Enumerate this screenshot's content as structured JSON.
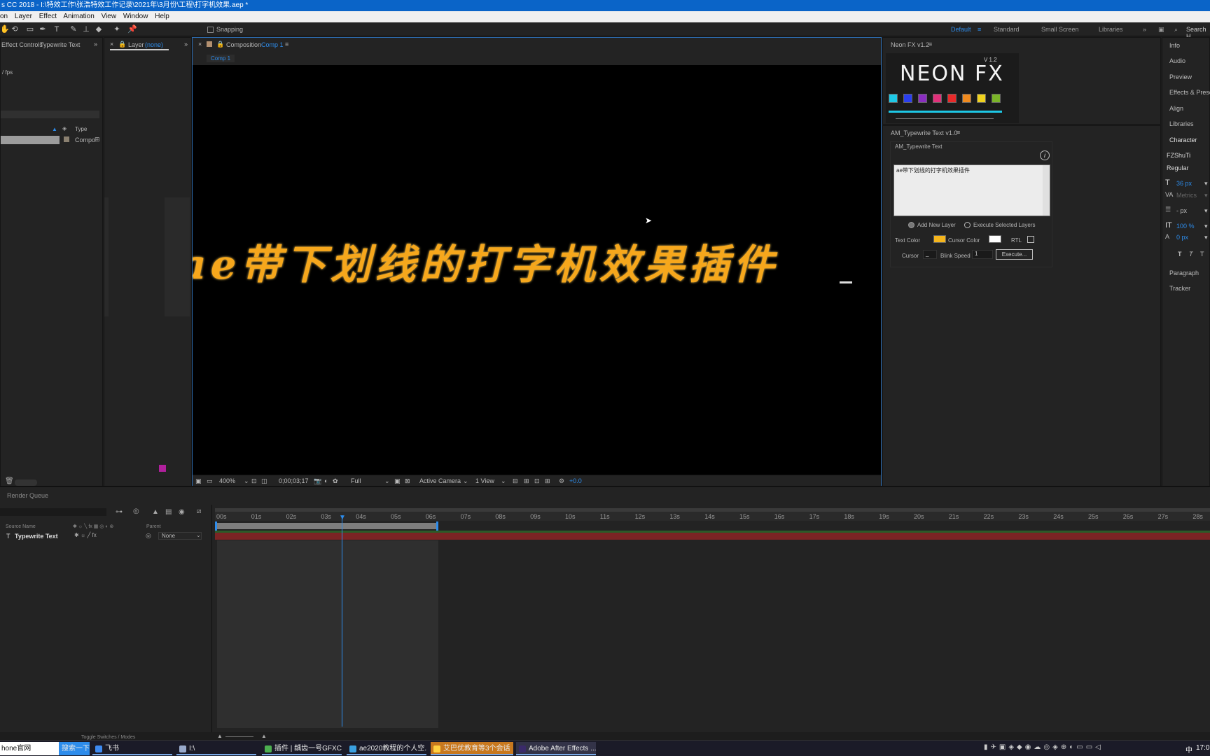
{
  "window": {
    "title": "s CC 2018 - I:\\特效工作\\张浩特效工作记录\\2021年\\3月份\\工程\\打字机效果.aep *"
  },
  "menu": [
    "on",
    "Layer",
    "Effect",
    "Animation",
    "View",
    "Window",
    "Help"
  ],
  "toolbar": {
    "snapping": "Snapping",
    "workspaces": [
      "Default",
      "Standard",
      "Small Screen",
      "Libraries"
    ],
    "search_placeholder": "Search H"
  },
  "left_panel": {
    "tab_effect_controls": "Effect Controls",
    "tab_layer_name": "Typewrite Text",
    "fps_text": "/ fps",
    "col_type": "Type",
    "row_type": "Compo"
  },
  "layer_panel": {
    "label": "Layer",
    "value": "(none)"
  },
  "composition": {
    "label": "Composition",
    "name": "Comp 1",
    "crumb": "Comp 1",
    "viewer_text": "ae带下划线的打字机效果插件"
  },
  "viewer_bar": {
    "zoom": "400%",
    "timecode": "0;00;03;17",
    "resolution": "Full",
    "camera": "Active Camera",
    "views": "1 View",
    "exposure": "+0.0"
  },
  "neon_fx": {
    "title": "Neon FX v1.2",
    "logo": "NEON FX",
    "version": "V 1.2",
    "colors": [
      "#1ec8e6",
      "#2a3ff0",
      "#8a2ec0",
      "#e0307a",
      "#e82a2a",
      "#f08a1e",
      "#f0d21e",
      "#7ab428"
    ],
    "accent": "#1ec8e6"
  },
  "typewrite": {
    "title": "AM_Typewrite Text v1.0",
    "group": "AM_Typewrite Text",
    "text_value": "ae带下划线的打字机效果插件",
    "opt_add": "Add New Layer",
    "opt_execute": "Execute Selected Layers",
    "text_color_label": "Text Color",
    "text_color": "#f5b51c",
    "cursor_color_label": "Cursor Color",
    "cursor_color": "#ffffff",
    "rtl_label": "RTL",
    "cursor_label": "Cursor",
    "cursor_value": "_",
    "blink_label": "Blink Speed",
    "blink_value": "1",
    "execute_button": "Execute..."
  },
  "right_panels": [
    "Info",
    "Audio",
    "Preview",
    "Effects & Presets",
    "Align",
    "Libraries",
    "Character"
  ],
  "character": {
    "font": "FZShuTi",
    "style": "Regular",
    "size": "36 px",
    "kerning": "Metrics",
    "leading_unit": "- px",
    "vscale": "100 %",
    "baseline": "0 px"
  },
  "right_panels_bottom": [
    "Paragraph",
    "Tracker"
  ],
  "timeline": {
    "render_queue": "Render Queue",
    "col_source": "Source Name",
    "col_parent": "Parent",
    "layer_name": "Typewrite Text",
    "parent_value": "None",
    "toggle": "Toggle Switches / Modes",
    "ruler": [
      "00s",
      "01s",
      "02s",
      "03s",
      "04s",
      "05s",
      "06s",
      "07s",
      "08s",
      "09s",
      "10s",
      "11s",
      "12s",
      "13s",
      "14s",
      "15s",
      "16s",
      "17s",
      "18s",
      "19s",
      "20s",
      "21s",
      "22s",
      "23s",
      "24s",
      "25s",
      "26s",
      "27s",
      "28s"
    ]
  },
  "taskbar": {
    "items": [
      "hone官网",
      "搜索一下",
      "飞书",
      "I:\\",
      "插件 | 龋齿一号GFXC...",
      "ae2020教程的个人空...",
      "艾巴优教育等3个会话",
      "Adobe After Effects ..."
    ],
    "tray_lang": "中",
    "clock": "17:0"
  }
}
